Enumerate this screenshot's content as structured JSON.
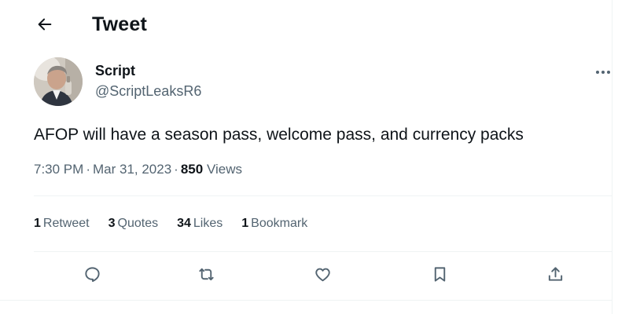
{
  "header": {
    "back_icon": "arrow-left-icon",
    "title": "Tweet"
  },
  "tweet": {
    "author": {
      "display_name": "Script",
      "handle": "@ScriptLeaksR6",
      "avatar_icon": "user-avatar"
    },
    "more_icon": "more-horizontal-icon",
    "text": "AFOP will have a season pass, welcome pass, and currency packs",
    "meta": {
      "time": "7:30 PM",
      "date": "Mar 31, 2023",
      "separator": "·",
      "views_count": "850",
      "views_label": "Views"
    },
    "stats": {
      "retweets": {
        "count": "1",
        "label": "Retweet"
      },
      "quotes": {
        "count": "3",
        "label": "Quotes"
      },
      "likes": {
        "count": "34",
        "label": "Likes"
      },
      "bookmarks": {
        "count": "1",
        "label": "Bookmark"
      }
    },
    "actions": [
      {
        "name": "reply",
        "icon": "reply-icon"
      },
      {
        "name": "retweet",
        "icon": "retweet-icon"
      },
      {
        "name": "like",
        "icon": "heart-icon"
      },
      {
        "name": "bookmark",
        "icon": "bookmark-icon"
      },
      {
        "name": "share",
        "icon": "share-icon"
      }
    ]
  },
  "colors": {
    "text_primary": "#0f1419",
    "text_secondary": "#536471",
    "divider": "#eff3f4",
    "background": "#ffffff"
  }
}
